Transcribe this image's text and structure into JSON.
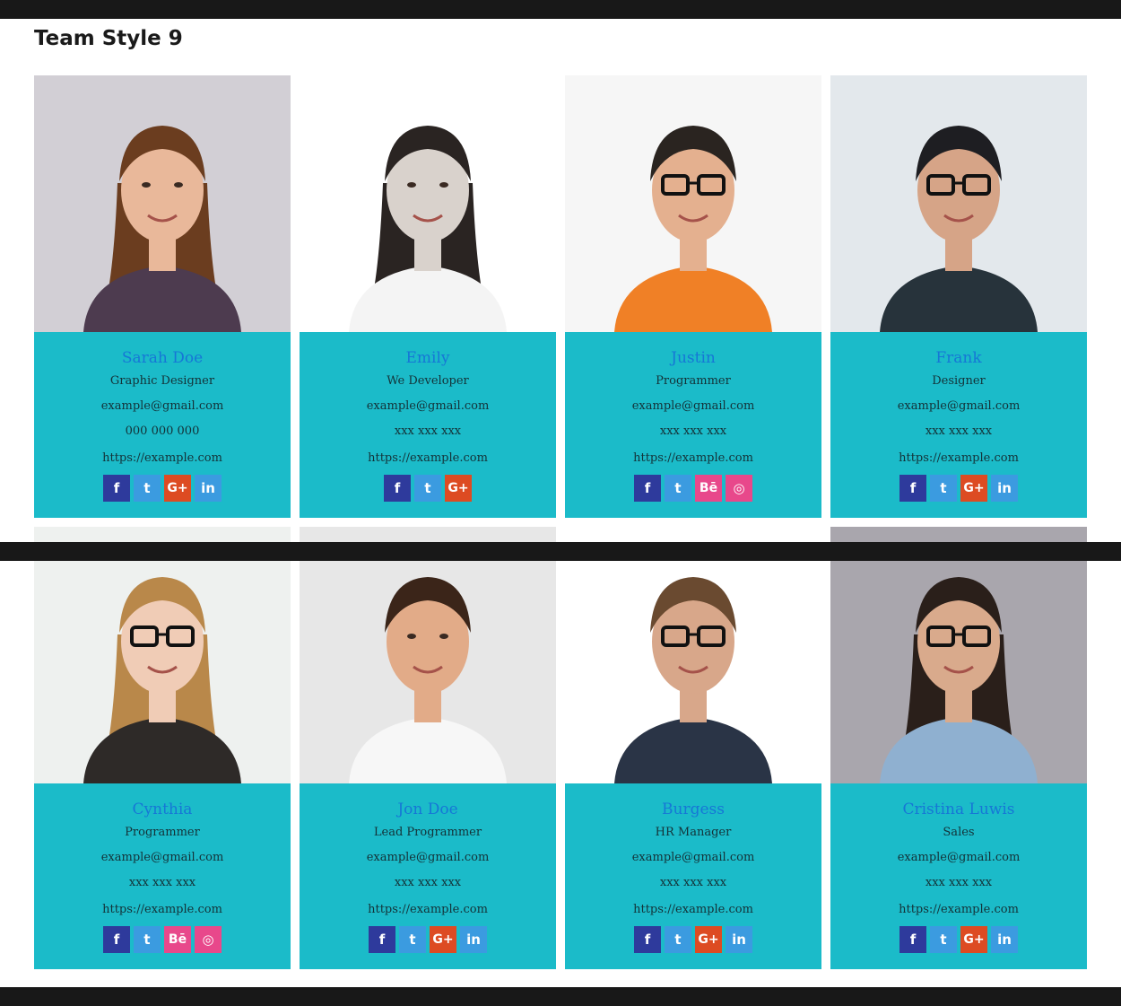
{
  "page": {
    "title": "Team Style 9"
  },
  "colors": {
    "card_bg": "#1bbbc9",
    "name": "#1677d6",
    "text": "#143238",
    "bars": "#181818"
  },
  "members": [
    {
      "name": "Sarah Doe",
      "role": "Graphic Designer",
      "email": "example@gmail.com",
      "phone": "000 000 000",
      "website": "https://example.com",
      "socials": [
        {
          "icon": "facebook-icon",
          "label": "f"
        },
        {
          "icon": "twitter-icon",
          "label": "t"
        },
        {
          "icon": "google-plus-icon",
          "label": "G+"
        },
        {
          "icon": "linkedin-icon",
          "label": "in"
        }
      ]
    },
    {
      "name": "Emily",
      "role": "We Developer",
      "email": "example@gmail.com",
      "phone": "xxx xxx xxx",
      "website": "https://example.com",
      "socials": [
        {
          "icon": "facebook-icon",
          "label": "f"
        },
        {
          "icon": "twitter-icon",
          "label": "t"
        },
        {
          "icon": "google-plus-icon",
          "label": "G+"
        }
      ]
    },
    {
      "name": "Justin",
      "role": "Programmer",
      "email": "example@gmail.com",
      "phone": "xxx xxx xxx",
      "website": "https://example.com",
      "socials": [
        {
          "icon": "facebook-icon",
          "label": "f"
        },
        {
          "icon": "twitter-icon",
          "label": "t"
        },
        {
          "icon": "behance-icon",
          "label": "Bē"
        },
        {
          "icon": "dribbble-icon",
          "label": "◎"
        }
      ]
    },
    {
      "name": "Frank",
      "role": "Designer",
      "email": "example@gmail.com",
      "phone": "xxx xxx xxx",
      "website": "https://example.com",
      "socials": [
        {
          "icon": "facebook-icon",
          "label": "f"
        },
        {
          "icon": "twitter-icon",
          "label": "t"
        },
        {
          "icon": "google-plus-icon",
          "label": "G+"
        },
        {
          "icon": "linkedin-icon",
          "label": "in"
        }
      ]
    },
    {
      "name": "Cynthia",
      "role": "Programmer",
      "email": "example@gmail.com",
      "phone": "xxx xxx xxx",
      "website": "https://example.com",
      "socials": [
        {
          "icon": "facebook-icon",
          "label": "f"
        },
        {
          "icon": "twitter-icon",
          "label": "t"
        },
        {
          "icon": "behance-icon",
          "label": "Bē"
        },
        {
          "icon": "dribbble-icon",
          "label": "◎"
        }
      ]
    },
    {
      "name": "Jon Doe",
      "role": "Lead Programmer",
      "email": "example@gmail.com",
      "phone": "xxx xxx xxx",
      "website": "https://example.com",
      "socials": [
        {
          "icon": "facebook-icon",
          "label": "f"
        },
        {
          "icon": "twitter-icon",
          "label": "t"
        },
        {
          "icon": "google-plus-icon",
          "label": "G+"
        },
        {
          "icon": "linkedin-icon",
          "label": "in"
        }
      ]
    },
    {
      "name": "Burgess",
      "role": "HR Manager",
      "email": "example@gmail.com",
      "phone": "xxx xxx xxx",
      "website": "https://example.com",
      "socials": [
        {
          "icon": "facebook-icon",
          "label": "f"
        },
        {
          "icon": "twitter-icon",
          "label": "t"
        },
        {
          "icon": "google-plus-icon",
          "label": "G+"
        },
        {
          "icon": "linkedin-icon",
          "label": "in"
        }
      ]
    },
    {
      "name": "Cristina Luwis",
      "role": "Sales",
      "email": "example@gmail.com",
      "phone": "xxx xxx xxx",
      "website": "https://example.com",
      "socials": [
        {
          "icon": "facebook-icon",
          "label": "f"
        },
        {
          "icon": "twitter-icon",
          "label": "t"
        },
        {
          "icon": "google-plus-icon",
          "label": "G+"
        },
        {
          "icon": "linkedin-icon",
          "label": "in"
        }
      ]
    }
  ]
}
